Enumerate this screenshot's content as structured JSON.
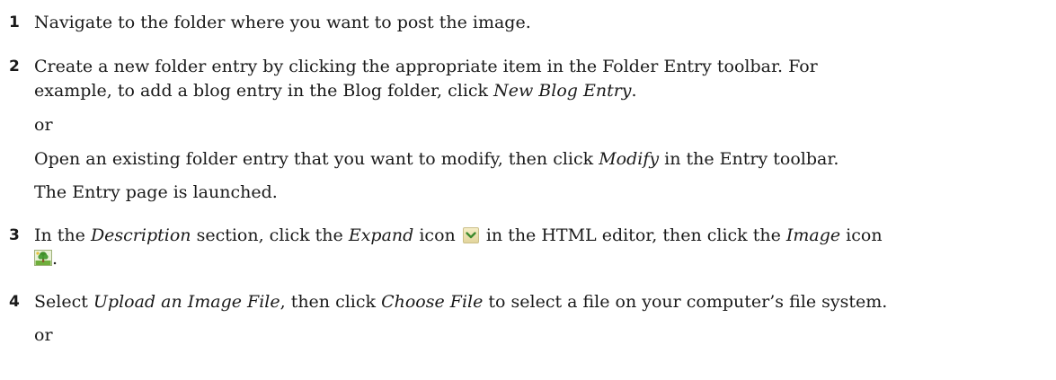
{
  "steps": [
    {
      "number": "1",
      "text": "Navigate to the folder where you want to post the image."
    },
    {
      "number": "2",
      "line1": "Create a new folder entry by clicking the appropriate item in the Folder Entry toolbar. For",
      "line2_pre": "example, to add a blog entry in the Blog folder, click ",
      "line2_em": "New Blog Entry",
      "line2_post": ".",
      "or": "or",
      "alt_pre": "Open an existing folder entry that you want to modify, then click ",
      "alt_em": "Modify",
      "alt_post": " in the Entry toolbar.",
      "result": "The Entry page is launched."
    },
    {
      "number": "3",
      "pre": "In the ",
      "em1": "Description",
      "mid1": " section, click the ",
      "em2": "Expand",
      "mid2": " icon ",
      "mid3": " in the HTML editor, then click the ",
      "em3": "Image",
      "post": " icon",
      "end": ".",
      "icons": {
        "expand": "chevron-down-icon",
        "image": "tree-image-icon"
      }
    },
    {
      "number": "4",
      "pre": "Select ",
      "em1": "Upload an Image File",
      "mid": ", then click ",
      "em2": "Choose File",
      "post": " to select a file on your computer’s file system.",
      "or": "or"
    }
  ]
}
